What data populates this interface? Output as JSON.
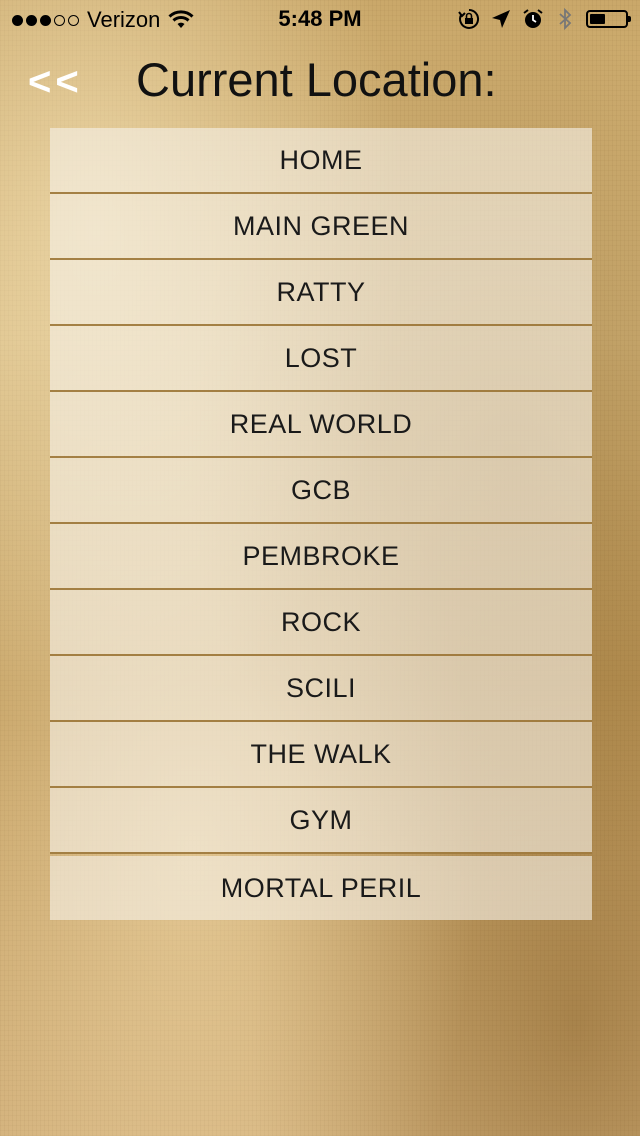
{
  "status_bar": {
    "carrier": "Verizon",
    "time": "5:48 PM",
    "signal_bars_filled": 3,
    "signal_bars_total": 5,
    "icons": [
      "wifi-icon",
      "orientation-lock-icon",
      "location-arrow-icon",
      "alarm-icon",
      "bluetooth-icon",
      "battery-icon"
    ],
    "battery_level": 0.45
  },
  "header": {
    "back_label": "<<",
    "title": "Current Location:"
  },
  "locations": [
    {
      "label": "HOME"
    },
    {
      "label": "MAIN GREEN"
    },
    {
      "label": "RATTY"
    },
    {
      "label": "LOST"
    },
    {
      "label": "REAL WORLD"
    },
    {
      "label": "GCB"
    },
    {
      "label": "PEMBROKE"
    },
    {
      "label": "ROCK"
    },
    {
      "label": "SCILI"
    },
    {
      "label": "THE WALK"
    },
    {
      "label": "GYM"
    },
    {
      "label": "MORTAL PERIL"
    }
  ],
  "colors": {
    "background": "#caa86a",
    "row_background": "#f5f0e6",
    "divider": "#966e2d",
    "back_text": "#ffffff"
  }
}
